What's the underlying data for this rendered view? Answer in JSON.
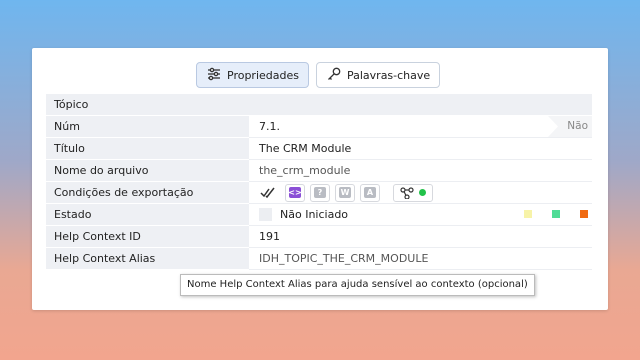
{
  "tabs": {
    "properties_label": "Propriedades",
    "keywords_label": "Palavras-chave"
  },
  "section_header": "Tópico",
  "rows": {
    "num": {
      "label": "Núm",
      "value": "7.1.",
      "badge": "Não"
    },
    "title": {
      "label": "Título",
      "value": "The CRM Module"
    },
    "filename": {
      "label": "Nome do arquivo",
      "value": "the_crm_module"
    },
    "export": {
      "label": "Condições de exportação"
    },
    "status": {
      "label": "Estado",
      "value": "Não Iniciado"
    },
    "help_id": {
      "label": "Help Context ID",
      "value": "191"
    },
    "help_alias": {
      "label": "Help Context Alias",
      "value": "IDH_TOPIC_THE_CRM_MODULE"
    }
  },
  "export_icons": [
    "checkmark-icon",
    "code-icon",
    "help-icon",
    "word-icon",
    "pdf-icon",
    "workflow-icon"
  ],
  "status_colors": [
    "#f7f3a8",
    "#4fdc96",
    "#f06a12"
  ],
  "tooltip": "Nome Help Context Alias para ajuda sensível ao contexto (opcional)",
  "colors": {
    "code_icon": "#8a4fd6",
    "gray_icon": "#b9bcc3",
    "online_dot": "#22c24a"
  }
}
